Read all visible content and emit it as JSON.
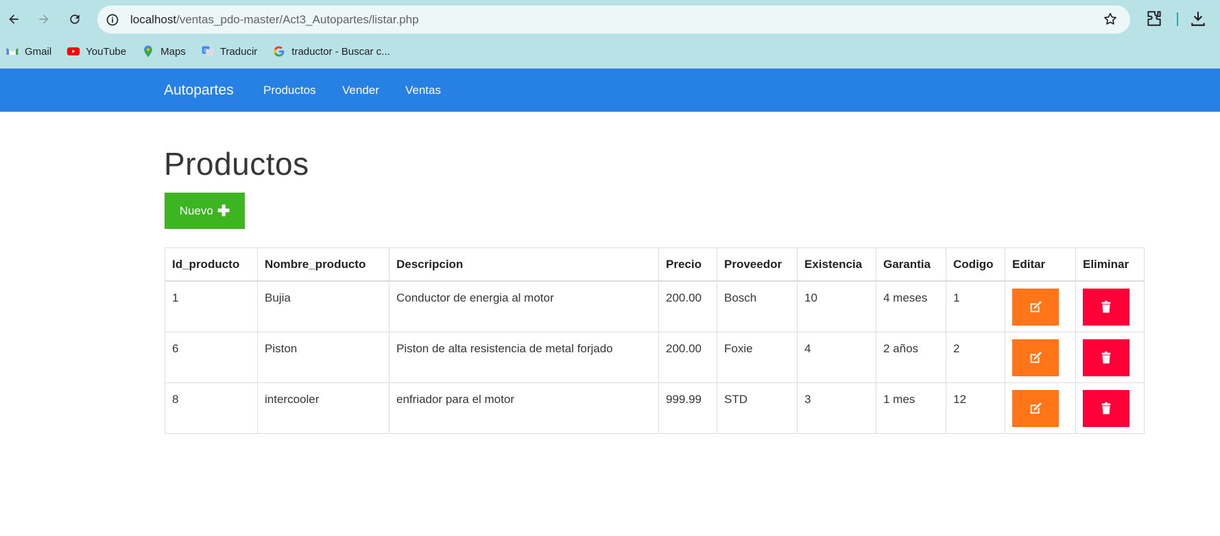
{
  "browser": {
    "url_host": "localhost",
    "url_path": "/ventas_pdo-master/Act3_Autopartes/listar.php",
    "bookmarks": [
      {
        "label": "Gmail",
        "icon": "gmail-icon"
      },
      {
        "label": "YouTube",
        "icon": "youtube-icon"
      },
      {
        "label": "Maps",
        "icon": "maps-icon"
      },
      {
        "label": "Traducir",
        "icon": "translate-icon"
      },
      {
        "label": "traductor - Buscar c...",
        "icon": "google-icon"
      }
    ]
  },
  "navbar": {
    "brand": "Autopartes",
    "links": [
      "Productos",
      "Vender",
      "Ventas"
    ],
    "color": "#2780e3"
  },
  "main": {
    "title": "Productos",
    "new_button": "Nuevo",
    "table": {
      "headers": [
        "Id_producto",
        "Nombre_producto",
        "Descripcion",
        "Precio",
        "Proveedor",
        "Existencia",
        "Garantia",
        "Codigo",
        "Editar",
        "Eliminar"
      ],
      "rows": [
        [
          "1",
          "Bujia",
          "Conductor de energia al motor",
          "200.00",
          "Bosch",
          "10",
          "4 meses",
          "1"
        ],
        [
          "6",
          "Piston",
          "Piston de alta resistencia de metal forjado",
          "200.00",
          "Foxie",
          "4",
          "2 años",
          "2"
        ],
        [
          "8",
          "intercooler",
          "enfriador para el motor",
          "999.99",
          "STD",
          "3",
          "1 mes",
          "12"
        ]
      ]
    },
    "colors": {
      "new": "#3cb521",
      "edit": "#ff7518",
      "delete": "#ff0039"
    }
  }
}
